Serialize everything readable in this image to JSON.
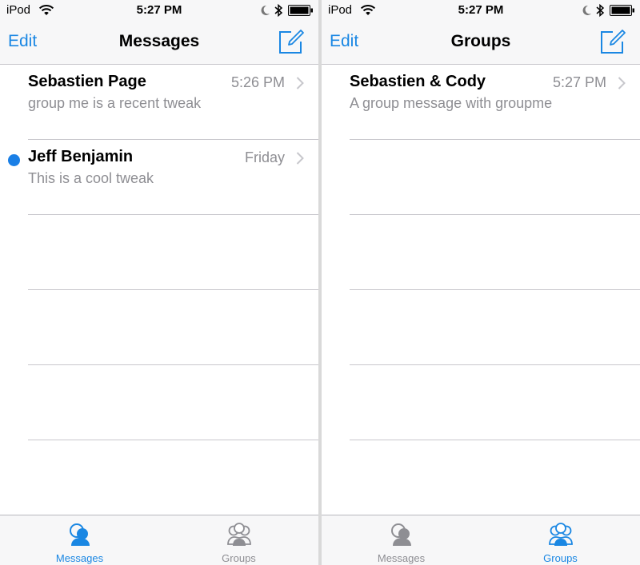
{
  "colors": {
    "accent": "#1a87e3",
    "unread": "#1a7fe6",
    "secondary_text": "#8e8e93"
  },
  "screens": [
    {
      "status": {
        "device": "iPod",
        "time": "5:27 PM"
      },
      "nav": {
        "edit_label": "Edit",
        "title": "Messages"
      },
      "rows": [
        {
          "name": "Sebastien Page",
          "time": "5:26 PM",
          "preview": "group me is a recent tweak",
          "unread": false
        },
        {
          "name": "Jeff Benjamin",
          "time": "Friday",
          "preview": "This is a cool tweak",
          "unread": true
        }
      ],
      "tabs": [
        {
          "label": "Messages",
          "icon": "messages-tab-icon",
          "active": true
        },
        {
          "label": "Groups",
          "icon": "groups-tab-icon",
          "active": false
        }
      ]
    },
    {
      "status": {
        "device": "iPod",
        "time": "5:27 PM"
      },
      "nav": {
        "edit_label": "Edit",
        "title": "Groups"
      },
      "rows": [
        {
          "name": "Sebastien & Cody",
          "time": "5:27 PM",
          "preview": "A group message with groupme",
          "unread": false
        }
      ],
      "tabs": [
        {
          "label": "Messages",
          "icon": "messages-tab-icon",
          "active": false
        },
        {
          "label": "Groups",
          "icon": "groups-tab-icon",
          "active": true
        }
      ]
    }
  ]
}
